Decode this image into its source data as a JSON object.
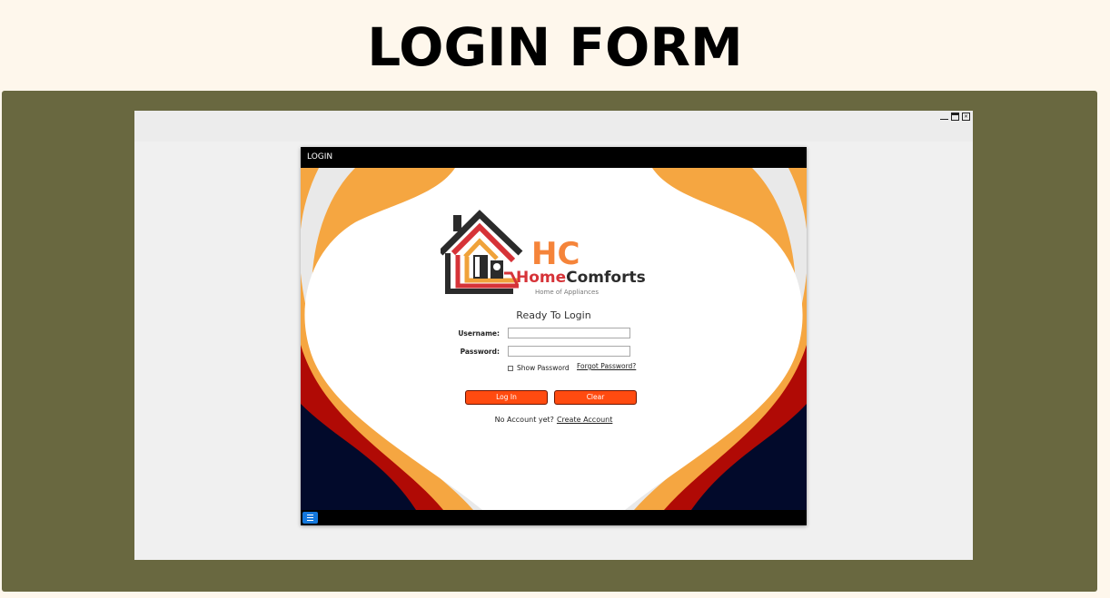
{
  "page": {
    "title": "LOGIN FORM"
  },
  "window_controls": {
    "minimize": "_",
    "maximize": "",
    "close": "✕"
  },
  "login_window": {
    "title": "LOGIN"
  },
  "logo": {
    "initials": "HC",
    "brand": "HomeComforts",
    "brand_home": "Home",
    "brand_comforts": "Comforts",
    "tagline": "Home of Appliances"
  },
  "form": {
    "heading": "Ready To Login",
    "username_label": "Username:",
    "username_value": "",
    "password_label": "Password:",
    "password_value": "",
    "show_password_label": "Show Password",
    "show_password_checked": false,
    "forgot_password_label": "Forgot Password?",
    "login_button": "Log In",
    "clear_button": "Clear",
    "no_account_text": "No Account yet?",
    "create_account_link": "Create Account"
  },
  "colors": {
    "accent": "#ff4b10",
    "background_wave_orange": "#f5a641",
    "background_wave_red": "#b00a05",
    "background_navy": "#020a2b",
    "frame": "#696840",
    "page_background": "#fef7ec"
  },
  "icons": [
    "minimize-icon",
    "maximize-icon",
    "close-icon",
    "menu-icon",
    "house-logo-icon"
  ]
}
